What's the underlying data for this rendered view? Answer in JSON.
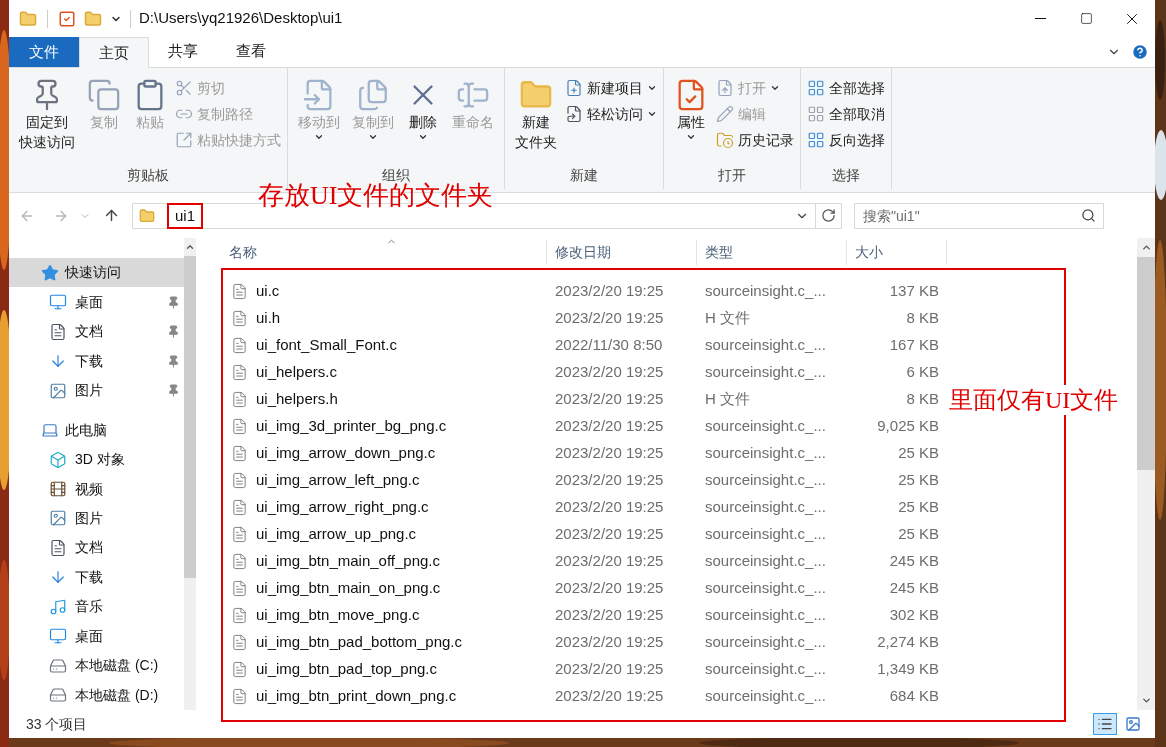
{
  "window": {
    "title": "D:\\Users\\yq21926\\Desktop\\ui1"
  },
  "ribbon_tabs": [
    {
      "label": "文件",
      "kind": "file"
    },
    {
      "label": "主页",
      "kind": "tab",
      "selected": true
    },
    {
      "label": "共享",
      "kind": "tab",
      "selected": false
    },
    {
      "label": "查看",
      "kind": "tab",
      "selected": false
    }
  ],
  "ribbon_groups": [
    {
      "label": "剪贴板",
      "items": [
        {
          "label_lines": [
            "固定到",
            "快速访问"
          ],
          "kind": "large",
          "disabled": false,
          "has_menu": false
        },
        {
          "label": "复制",
          "kind": "large",
          "disabled": true,
          "has_menu": false
        },
        {
          "label": "粘贴",
          "kind": "large",
          "disabled": true,
          "has_menu": false
        },
        {
          "label": "剪切",
          "kind": "small",
          "disabled": true,
          "has_menu": false
        },
        {
          "label": "复制路径",
          "kind": "small",
          "disabled": true,
          "has_menu": false
        },
        {
          "label": "粘贴快捷方式",
          "kind": "small",
          "disabled": true,
          "has_menu": false
        }
      ]
    },
    {
      "label": "组织",
      "items": [
        {
          "label": "移动到",
          "kind": "large",
          "disabled": true,
          "has_menu": true
        },
        {
          "label": "复制到",
          "kind": "large",
          "disabled": true,
          "has_menu": true
        },
        {
          "label": "删除",
          "kind": "large",
          "disabled": false,
          "has_menu": true
        },
        {
          "label": "重命名",
          "kind": "large",
          "disabled": true,
          "has_menu": false
        }
      ]
    },
    {
      "label": "新建",
      "items": [
        {
          "label_lines": [
            "新建",
            "文件夹"
          ],
          "kind": "large",
          "disabled": false,
          "has_menu": false
        },
        {
          "label": "新建项目",
          "kind": "small",
          "disabled": false,
          "has_menu": true
        },
        {
          "label": "轻松访问",
          "kind": "small",
          "disabled": false,
          "has_menu": true
        }
      ]
    },
    {
      "label": "打开",
      "items": [
        {
          "label": "属性",
          "kind": "large",
          "disabled": false,
          "has_menu": true
        },
        {
          "label": "打开",
          "kind": "small",
          "disabled": true,
          "has_menu": true
        },
        {
          "label": "编辑",
          "kind": "small",
          "disabled": true,
          "has_menu": false
        },
        {
          "label": "历史记录",
          "kind": "small",
          "disabled": false,
          "has_menu": false
        }
      ]
    },
    {
      "label": "选择",
      "items": [
        {
          "label": "全部选择",
          "kind": "small",
          "disabled": false,
          "has_menu": false
        },
        {
          "label": "全部取消",
          "kind": "small",
          "disabled": false,
          "has_menu": false
        },
        {
          "label": "反向选择",
          "kind": "small",
          "disabled": false,
          "has_menu": false
        }
      ]
    }
  ],
  "address": {
    "folder": "ui1"
  },
  "search": {
    "placeholder": "搜索\"ui1\""
  },
  "sidebar": {
    "items": [
      {
        "label": "快速访问",
        "selected": true,
        "children": [
          {
            "label": "桌面",
            "pinned": true
          },
          {
            "label": "文档",
            "pinned": true
          },
          {
            "label": "下载",
            "pinned": true
          },
          {
            "label": "图片",
            "pinned": true
          }
        ]
      },
      {
        "label": "此电脑",
        "selected": false,
        "children": [
          {
            "label": "3D 对象",
            "pinned": false
          },
          {
            "label": "视频",
            "pinned": false
          },
          {
            "label": "图片",
            "pinned": false
          },
          {
            "label": "文档",
            "pinned": false
          },
          {
            "label": "下载",
            "pinned": false
          },
          {
            "label": "音乐",
            "pinned": false
          },
          {
            "label": "桌面",
            "pinned": false
          },
          {
            "label": "本地磁盘 (C:)",
            "pinned": false
          },
          {
            "label": "本地磁盘 (D:)",
            "pinned": false
          }
        ]
      }
    ]
  },
  "table": {
    "columns": [
      "名称",
      "修改日期",
      "类型",
      "大小"
    ],
    "rows": [
      [
        "ui.c",
        "2023/2/20 19:25",
        "sourceinsight.c_...",
        "137 KB"
      ],
      [
        "ui.h",
        "2023/2/20 19:25",
        "H 文件",
        "8 KB"
      ],
      [
        "ui_font_Small_Font.c",
        "2022/11/30 8:50",
        "sourceinsight.c_...",
        "167 KB"
      ],
      [
        "ui_helpers.c",
        "2023/2/20 19:25",
        "sourceinsight.c_...",
        "6 KB"
      ],
      [
        "ui_helpers.h",
        "2023/2/20 19:25",
        "H 文件",
        "8 KB"
      ],
      [
        "ui_img_3d_printer_bg_png.c",
        "2023/2/20 19:25",
        "sourceinsight.c_...",
        "9,025 KB"
      ],
      [
        "ui_img_arrow_down_png.c",
        "2023/2/20 19:25",
        "sourceinsight.c_...",
        "25 KB"
      ],
      [
        "ui_img_arrow_left_png.c",
        "2023/2/20 19:25",
        "sourceinsight.c_...",
        "25 KB"
      ],
      [
        "ui_img_arrow_right_png.c",
        "2023/2/20 19:25",
        "sourceinsight.c_...",
        "25 KB"
      ],
      [
        "ui_img_arrow_up_png.c",
        "2023/2/20 19:25",
        "sourceinsight.c_...",
        "25 KB"
      ],
      [
        "ui_img_btn_main_off_png.c",
        "2023/2/20 19:25",
        "sourceinsight.c_...",
        "245 KB"
      ],
      [
        "ui_img_btn_main_on_png.c",
        "2023/2/20 19:25",
        "sourceinsight.c_...",
        "245 KB"
      ],
      [
        "ui_img_btn_move_png.c",
        "2023/2/20 19:25",
        "sourceinsight.c_...",
        "302 KB"
      ],
      [
        "ui_img_btn_pad_bottom_png.c",
        "2023/2/20 19:25",
        "sourceinsight.c_...",
        "2,274 KB"
      ],
      [
        "ui_img_btn_pad_top_png.c",
        "2023/2/20 19:25",
        "sourceinsight.c_...",
        "1,349 KB"
      ],
      [
        "ui_img_btn_print_down_png.c",
        "2023/2/20 19:25",
        "sourceinsight.c_...",
        "684 KB"
      ]
    ]
  },
  "status_bar": {
    "count": "33 个项目",
    "views": [
      {
        "selected": true
      },
      {
        "selected": false
      }
    ]
  },
  "annotations": [
    {
      "kind": "folder-note",
      "text": "存放UI文件的文件夹"
    },
    {
      "kind": "list-note",
      "text": "里面仅有UI文件"
    }
  ]
}
